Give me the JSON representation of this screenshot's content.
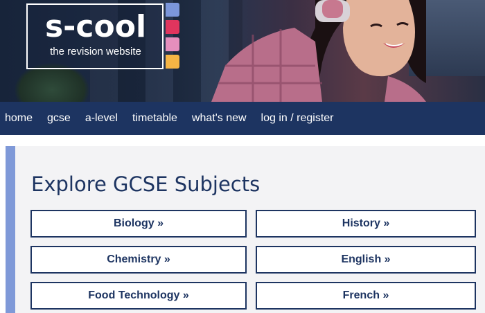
{
  "logo": {
    "title": "s-cool",
    "subtitle": "the revision website",
    "tab_colors": [
      "#7b96db",
      "#e0355e",
      "#e58fbd",
      "#f6b545"
    ]
  },
  "nav": {
    "items": [
      "home",
      "gcse",
      "a-level",
      "timetable",
      "what's new",
      "log in / register"
    ]
  },
  "main": {
    "heading": "Explore GCSE Subjects",
    "subjects_left": [
      "Biology »",
      "Chemistry »",
      "Food Technology »"
    ],
    "subjects_right": [
      "History »",
      "English »",
      "French »"
    ]
  },
  "colors": {
    "nav_bg": "#1d3461",
    "accent_bar": "#7f99d8",
    "text_primary": "#1d3461"
  }
}
